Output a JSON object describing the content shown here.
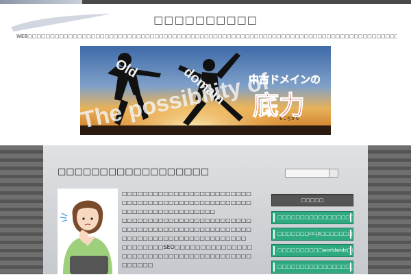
{
  "header": {
    "site_title": "□□□□□□□□□□",
    "tagline": "WEB□□□□□□□□□□□□□□□□□□□□□□□□□□□□□□□□□□□□□□□□□□□□□□□□□□□□□□□□□□□□□□□□□□□□□□□□□□□□□□□□□□□□□□□□□□□□□□□□□□□□□□□□□□□□□□□□□□□□□□□□□□□□□□□□□□"
  },
  "banner": {
    "text_arc": "The possibility of",
    "text_old": "Old",
    "text_domain": "domain",
    "jp_line": "中古ドメインの",
    "jp_big": "底力",
    "jp_ruby": "そこぢから"
  },
  "post": {
    "title": "□□□□□□□□□□□□□□□□□□",
    "paragraphs": [
      "□□□□□□□□□□□□□□□□□□□□□□□□□□□□□□□□□□□□□□□□□□□□□□□□□□□□□□□□□□□□□□□□□□□□",
      "□□□□□□□□□□□□□□□□□□□□□□□□□□□□□□□□□□□□□□□□□□□□□□□□□□□□□□□□□□□□□□□□□□□□□□□□□□",
      "□□□□□□□□SEO□□□□□□□□□□□□□□□□□□□□□□□□□□□□□□□□□□□□□□□□□□□□□□"
    ]
  },
  "sidebar": {
    "menu_heading": "□□□□□",
    "menu_items": [
      "□□□□□□□□□□□□□□□□□□□□□□",
      "□□□□□□□co.jp□□□□□□□□□□",
      "□□□□□□□□□□worldwide□□□",
      "□□□□□□□□□□□□□□□□□□□□□□□"
    ]
  },
  "colors": {
    "menu_green": "#2faa80",
    "menu_head": "#555555",
    "stripe_dark": "#555555"
  }
}
